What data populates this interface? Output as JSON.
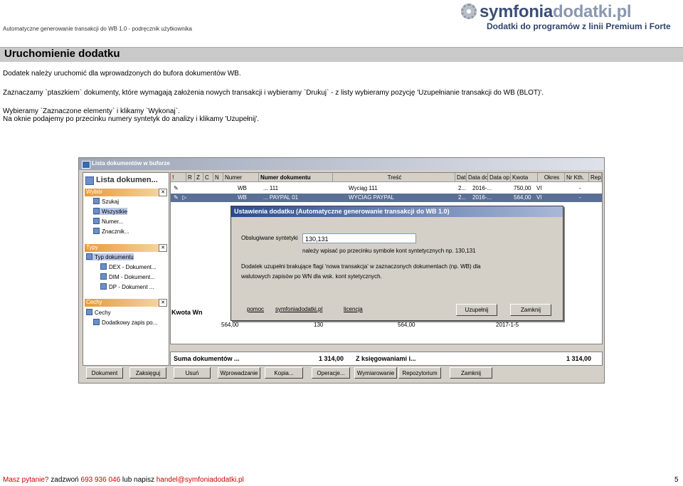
{
  "header": {
    "doc_title": "Automatyczne generowanie transakcji do WB 1.0  - podręcznik użytkownika",
    "logo_main_a": "symfonia",
    "logo_main_b": "dodatki.pl",
    "logo_sub": "Dodatki do programów z linii Premium i Forte"
  },
  "section": {
    "title": "Uruchomienie dodatku",
    "p1": "Dodatek należy uruchomić dla wprowadzonych do bufora dokumentów  WB.",
    "p2": "Zaznaczamy  `ptaszkiem`  dokumenty, które wymagają założenia nowych transakcji i wybieramy `Drukuj` - z listy wybieramy pozycję 'Uzupełnianie transakcji do WB (BLOT)'.",
    "p3": "Wybieramy `Zaznaczone elementy` i klikamy `Wykonaj`.",
    "p4": "Na oknie podajemy po przecinku numery syntetyk do analizy i klikamy 'Uzupełnij'."
  },
  "app": {
    "window_title": "Lista dokumentów w buforze",
    "list_title": "Lista dokumen...",
    "groups": {
      "wybor": "Wybór",
      "typy": "Typy",
      "cechy": "Cechy"
    },
    "wybor_items": [
      "Szukaj",
      "Wszystkie",
      "Numer...",
      "Znacznik..."
    ],
    "typy_items": [
      "Typ dokumentu",
      "DEX - Dokument...",
      "DIM - Dokument...",
      "DP - Dokument ..."
    ],
    "cechy_items": [
      "Cechy",
      "Dodatkowy zapis po..."
    ],
    "grid_headers": [
      "!",
      "R",
      "Z",
      "C",
      "N",
      "Numer",
      "Numer dokumentu",
      "Treść",
      "Dat",
      "Data do",
      "Data op",
      "Kwota",
      "Okres",
      "Nr Kth.",
      "Rep"
    ],
    "rows": [
      {
        "typ": "WB",
        "numer": "... 111",
        "tresc": "Wyciąg 111",
        "dat": "2...",
        "data_op": "2016-...",
        "kwota": "750,00",
        "okres": "VI",
        "kth": "-"
      },
      {
        "typ": "WB",
        "numer": "... PAYPAL 01",
        "tresc": "WYCIAG PAYPAL",
        "dat": "2...",
        "data_op": "2016-...",
        "kwota": "564,00",
        "okres": "VI",
        "kth": "-"
      }
    ],
    "kwota_label": "Kwota Wn",
    "kwota_row": [
      "564,00",
      "130",
      "564,00",
      "2017-1-5"
    ],
    "sum_label": "Suma dokumentów ...",
    "sum_value_1": "1 314,00",
    "sum_middle": "Z księgowaniami i...",
    "sum_value_2": "1 314,00",
    "buttons": [
      "Dokument",
      "Zaksięguj",
      "Usuń",
      "Wprowadzanie",
      "Kopia...",
      "Operacje...",
      "Wymiarowanie",
      "Repozytorium",
      "Zamknij"
    ]
  },
  "dialog": {
    "title": "Ustawienia dodatku (Automatyczne generowanie transakcji do WB 1.0)",
    "synt_label": "Obsługiwane syntetyki",
    "synt_value": "130,131",
    "hint": "należy wpisać po przecinku symbole kont syntetycznych np. 130,131",
    "desc1": "Dodatek uzupełni brakujące flagi 'nowa transakcja' w zaznaczonych dokumentach (np. WB) dla",
    "desc2": "walutowych zapisów po WN dla wsk. kont sytetycznych.",
    "link_help": "pomoc",
    "link_site": "symfoniadodatki.pl",
    "link_license": "licencja",
    "btn_fill": "Uzupełnij",
    "btn_close": "Zamknij"
  },
  "footer": {
    "q": "Masz pytanie?",
    "call": " zadzwoń ",
    "phone": "693 936 046",
    "or": " lub napisz ",
    "email": "handel@symfoniadodatki.pl",
    "page": "5"
  }
}
